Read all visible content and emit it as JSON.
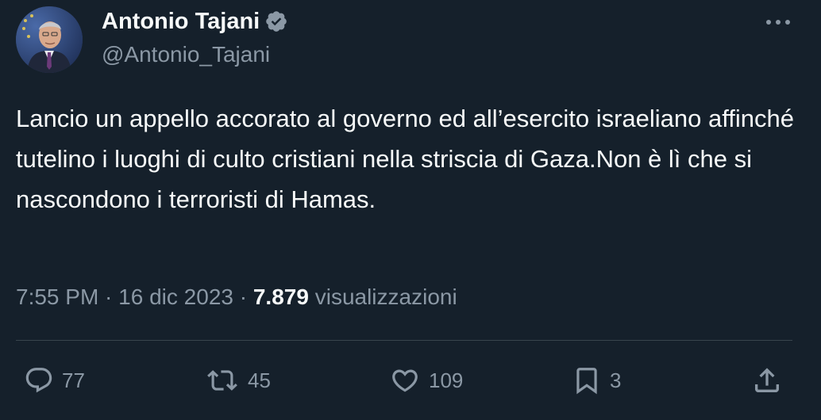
{
  "author": {
    "display_name": "Antonio Tajani",
    "handle": "@Antonio_Tajani",
    "verified": true,
    "avatar_icon": "profile-photo"
  },
  "tweet": {
    "text": "Lancio un appello accorato al governo ed all’esercito israeliano affinché tutelino i luoghi di culto cristiani nella striscia di Gaza.Non è lì che si nascondono i terroristi di Hamas."
  },
  "meta": {
    "time": "7:55 PM",
    "separator1": " · ",
    "date": "16 dic 2023",
    "separator2": " · ",
    "views_count": "7.879",
    "views_label": " visualizzazioni"
  },
  "actions": {
    "replies": "77",
    "retweets": "45",
    "likes": "109",
    "bookmarks": "3"
  },
  "colors": {
    "background": "#15202b",
    "text": "#f7f9f9",
    "secondary_text": "#8b98a5",
    "divider": "#38444d",
    "verified_badge": "#8b98a5"
  },
  "icons": {
    "more": "more-horizontal-icon",
    "reply": "reply-icon",
    "retweet": "retweet-icon",
    "like": "heart-icon",
    "bookmark": "bookmark-icon",
    "share": "share-icon"
  }
}
